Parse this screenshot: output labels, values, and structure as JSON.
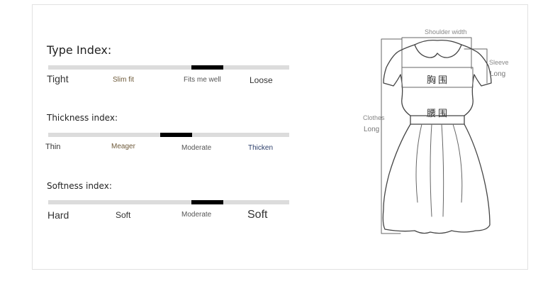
{
  "type_index": {
    "title": "Type Index:",
    "marker_position": 0.59,
    "labels": [
      "Tight",
      "Slim fit",
      "Fits me well",
      "Loose"
    ]
  },
  "thickness_index": {
    "title": "Thickness index:",
    "marker_position": 0.46,
    "labels": [
      "Thin",
      "Meager",
      "Moderate",
      "Thicken"
    ]
  },
  "softness_index": {
    "title": "Softness index:",
    "marker_position": 0.59,
    "labels": [
      "Hard",
      "Soft",
      "Moderate",
      "Soft"
    ]
  },
  "dress": {
    "shoulder_label": "Shoulder width",
    "sleeve_label": "Sleeve",
    "sleeve_sub": "Long",
    "chest_label": "胸围",
    "waist_label": "腰围",
    "clothes_label": "Clothes",
    "clothes_sub": "Long"
  }
}
